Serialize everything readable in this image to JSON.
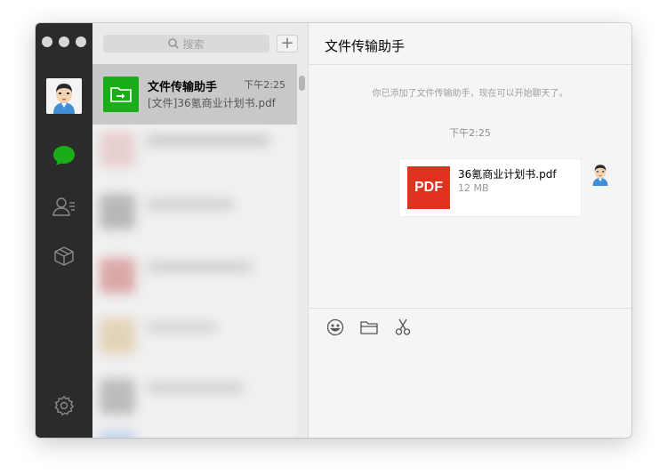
{
  "window": {
    "traffic_lights": [
      "close",
      "minimize",
      "maximize"
    ]
  },
  "sidebar": {
    "icons": [
      "avatar",
      "chat-bubble-icon",
      "contacts-icon",
      "favorites-box-icon",
      "settings-gear-icon"
    ],
    "active_color": "#1aad19"
  },
  "search": {
    "placeholder": "搜索"
  },
  "add_button": {
    "label": "+"
  },
  "conversations": [
    {
      "name": "文件传输助手",
      "time": "下午2:25",
      "preview": "[文件]36氪商业计划书.pdf"
    }
  ],
  "chat": {
    "title": "文件传输助手",
    "system_notice": "你已添加了文件传输助手，现在可以开始聊天了。",
    "timestamp": "下午2:25",
    "message": {
      "file_type": "PDF",
      "file_name": "36氪商业计划书.pdf",
      "file_size": "12 MB"
    }
  },
  "composer": {
    "tools": [
      "emoji-icon",
      "folder-icon",
      "scissors-icon"
    ]
  }
}
